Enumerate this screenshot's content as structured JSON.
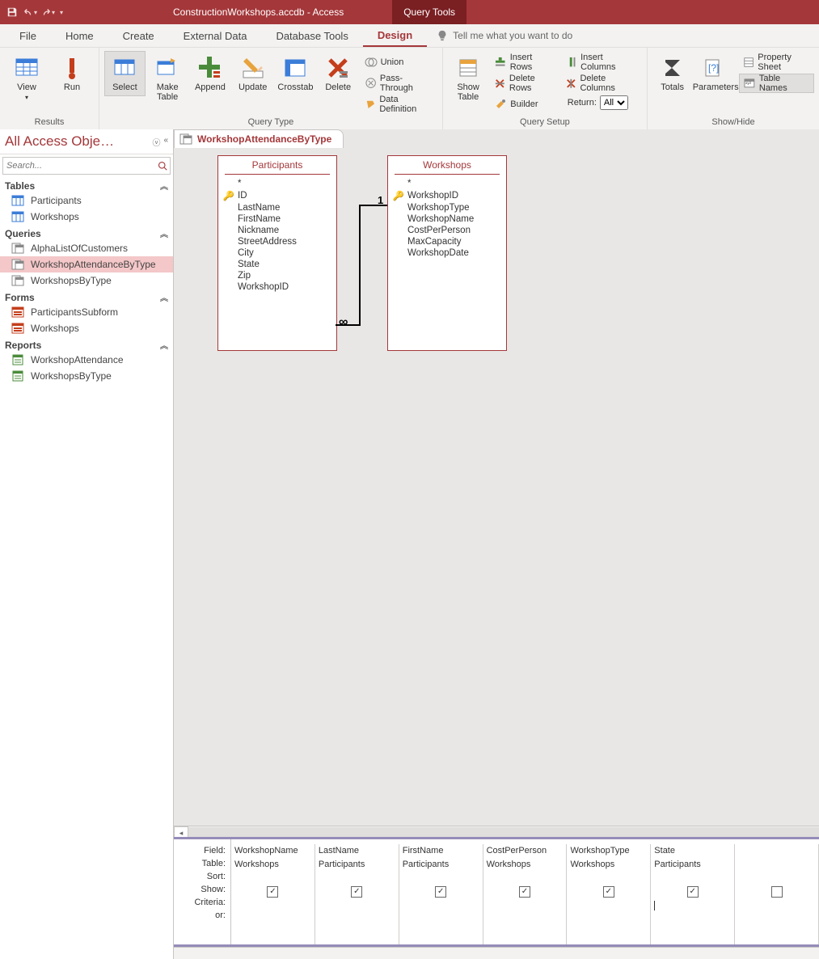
{
  "qat": {
    "save": "save",
    "undo": "undo",
    "redo": "redo"
  },
  "title": "ConstructionWorkshops.accdb - Access",
  "context_tab": "Query Tools",
  "tabs": [
    "File",
    "Home",
    "Create",
    "External Data",
    "Database Tools",
    "Design"
  ],
  "active_tab": "Design",
  "tell_me": "Tell me what you want to do",
  "ribbon": {
    "results": {
      "label": "Results",
      "view": "View",
      "run": "Run"
    },
    "querytype": {
      "label": "Query Type",
      "select": "Select",
      "maketable": "Make\nTable",
      "append": "Append",
      "update": "Update",
      "crosstab": "Crosstab",
      "delete": "Delete",
      "union": "Union",
      "passthrough": "Pass-Through",
      "datadef": "Data Definition"
    },
    "querysetup": {
      "label": "Query Setup",
      "showtable": "Show\nTable",
      "insertrows": "Insert Rows",
      "deleterows": "Delete Rows",
      "builder": "Builder",
      "insertcols": "Insert Columns",
      "deletecols": "Delete Columns",
      "returnlbl": "Return:",
      "returnval": "All"
    },
    "showhide": {
      "label": "Show/Hide",
      "totals": "Totals",
      "parameters": "Parameters",
      "propsheet": "Property Sheet",
      "tablenames": "Table Names"
    }
  },
  "nav": {
    "title": "All Access Obje…",
    "search_placeholder": "Search...",
    "sections": {
      "tables": {
        "label": "Tables",
        "items": [
          "Participants",
          "Workshops"
        ]
      },
      "queries": {
        "label": "Queries",
        "items": [
          "AlphaListOfCustomers",
          "WorkshopAttendanceByType",
          "WorkshopsByType"
        ],
        "selected": "WorkshopAttendanceByType"
      },
      "forms": {
        "label": "Forms",
        "items": [
          "ParticipantsSubform",
          "Workshops"
        ]
      },
      "reports": {
        "label": "Reports",
        "items": [
          "WorkshopAttendance",
          "WorkshopsByType"
        ]
      }
    }
  },
  "doc_tab": "WorkshopAttendanceByType",
  "design": {
    "tables": {
      "participants": {
        "title": "Participants",
        "fields": [
          "*",
          "ID",
          "LastName",
          "FirstName",
          "Nickname",
          "StreetAddress",
          "City",
          "State",
          "Zip",
          "WorkshopID"
        ],
        "key": "ID"
      },
      "workshops": {
        "title": "Workshops",
        "fields": [
          "*",
          "WorkshopID",
          "WorkshopType",
          "WorkshopName",
          "CostPerPerson",
          "MaxCapacity",
          "WorkshopDate"
        ],
        "key": "WorkshopID"
      }
    },
    "relation": {
      "one": "1",
      "many": "∞"
    }
  },
  "qbe": {
    "rowlabels": [
      "Field:",
      "Table:",
      "Sort:",
      "Show:",
      "Criteria:",
      "or:"
    ],
    "columns": [
      {
        "field": "WorkshopName",
        "table": "Workshops",
        "show": true
      },
      {
        "field": "LastName",
        "table": "Participants",
        "show": true
      },
      {
        "field": "FirstName",
        "table": "Participants",
        "show": true
      },
      {
        "field": "CostPerPerson",
        "table": "Workshops",
        "show": true
      },
      {
        "field": "WorkshopType",
        "table": "Workshops",
        "show": true
      },
      {
        "field": "State",
        "table": "Participants",
        "show": true,
        "criteria_focus": true
      }
    ]
  }
}
